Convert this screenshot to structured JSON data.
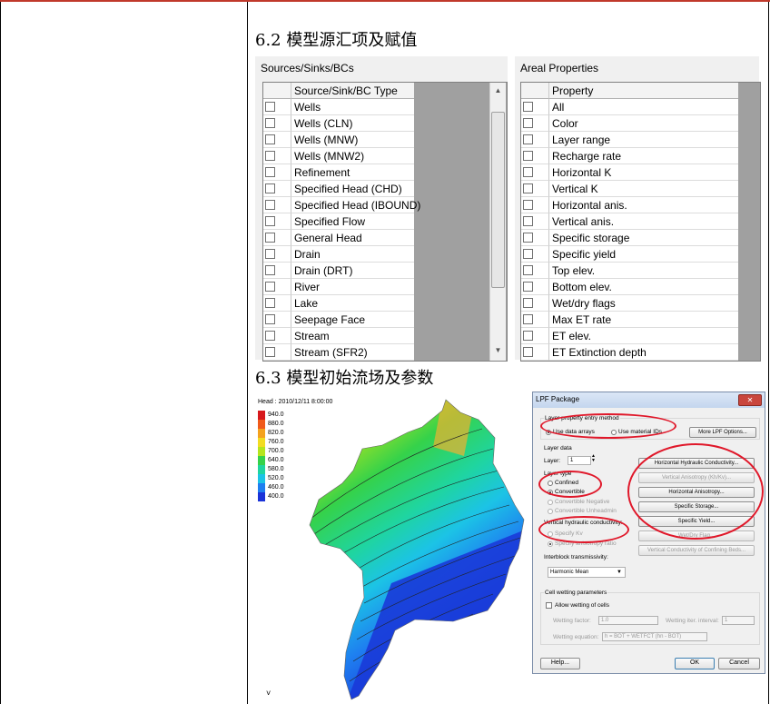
{
  "sections": {
    "s62": "6.2  模型源汇项及赋值",
    "s63": "6.3  模型初始流场及参数"
  },
  "sources_panel": {
    "title": "Sources/Sinks/BCs",
    "header": "Source/Sink/BC Type",
    "items": [
      "Wells",
      "Wells (CLN)",
      "Wells (MNW)",
      "Wells (MNW2)",
      "Refinement",
      "Specified Head (CHD)",
      "Specified Head (IBOUND)",
      "Specified Flow",
      "General Head",
      "Drain",
      "Drain (DRT)",
      "River",
      "Lake",
      "Seepage Face",
      "Stream",
      "Stream (SFR2)"
    ]
  },
  "areal_panel": {
    "title": "Areal Properties",
    "header": "Property",
    "items": [
      "All",
      "Color",
      "Layer range",
      "Recharge rate",
      "Horizontal K",
      "Vertical K",
      "Horizontal anis.",
      "Vertical anis.",
      "Specific storage",
      "Specific yield",
      "Top elev.",
      "Bottom elev.",
      "Wet/dry flags",
      "Max ET rate",
      "ET elev.",
      "ET Extinction depth"
    ]
  },
  "map": {
    "title": "Head : 2010/12/11 8:00:00",
    "legend": [
      {
        "label": "940.0",
        "color": "#d7191c"
      },
      {
        "label": "880.0",
        "color": "#f05a1a"
      },
      {
        "label": "820.0",
        "color": "#f4a21e"
      },
      {
        "label": "760.0",
        "color": "#f2dc22"
      },
      {
        "label": "700.0",
        "color": "#b5e51d"
      },
      {
        "label": "640.0",
        "color": "#35d24a"
      },
      {
        "label": "580.0",
        "color": "#1fd5a0"
      },
      {
        "label": "520.0",
        "color": "#1cc3e6"
      },
      {
        "label": "460.0",
        "color": "#1e7ef0"
      },
      {
        "label": "400.0",
        "color": "#1a33d8"
      }
    ],
    "bottom_mark": "˅"
  },
  "lpf": {
    "title": "LPF Package",
    "close": "✕",
    "grp_entry": "Layer property entry method",
    "use_data_arrays": "Use data arrays",
    "use_material_ids": "Use material IDs",
    "more_options": "More LPF Options...",
    "layer_data": "Layer data",
    "layer_label": "Layer:",
    "layer_value": "1",
    "layer_type": "Layer type",
    "confined": "Confined",
    "convertible": "Convertible",
    "convertible_negative": "Convertible Negative",
    "convertible_unheadmin": "Convertible Unheadmin",
    "vhc_label": "Vertical hydraulic conductivity:",
    "specify_kv": "Specify Kv",
    "specify_ratio": "Specify anisotropy ratio",
    "interblock": "Interblock transmissivity:",
    "harmonic": "Harmonic Mean",
    "btn_hk": "Horizontal Hydraulic Conductivity...",
    "btn_va": "Vertical Anisotropy (Kh/Kv)...",
    "btn_ha": "Horizontal Anisotropy...",
    "btn_ss": "Specific Storage...",
    "btn_sy": "Specific Yield...",
    "btn_wd": "Wet/Dry Flag...",
    "btn_vc": "Vertical Conductivity of Confining Beds...",
    "cell_wetting": "Cell wetting parameters",
    "allow_wetting": "Allow wetting of cells",
    "wetting_factor": "Wetting factor:",
    "wetting_factor_val": "1.0",
    "wetting_iter": "Wetting iter. interval:",
    "wetting_iter_val": "1",
    "wetting_eq": "Wetting equation:",
    "wetting_eq_val": "h = BOT + WETFCT (hn - BOT)",
    "help": "Help...",
    "ok": "OK",
    "cancel": "Cancel"
  }
}
